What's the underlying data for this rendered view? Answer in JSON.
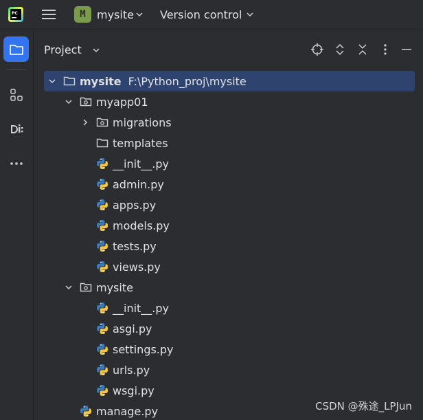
{
  "titlebar": {
    "app_logo_icon": "pycharm-logo-icon",
    "project_badge": "M",
    "project_name": "mysite",
    "vcs_label": "Version control",
    "badge_color": "#7a9a4c"
  },
  "panel": {
    "title": "Project"
  },
  "tree": [
    {
      "label": "mysite",
      "path": "F:\\Python_proj\\mysite",
      "type": "folder",
      "level": 0,
      "expanded": true,
      "selected": true
    },
    {
      "label": "myapp01",
      "type": "package",
      "level": 1,
      "expanded": true
    },
    {
      "label": "migrations",
      "type": "package",
      "level": 2,
      "expanded": false
    },
    {
      "label": "templates",
      "type": "folder",
      "level": 2
    },
    {
      "label": "__init__.py",
      "type": "python",
      "level": 2
    },
    {
      "label": "admin.py",
      "type": "python",
      "level": 2
    },
    {
      "label": "apps.py",
      "type": "python",
      "level": 2
    },
    {
      "label": "models.py",
      "type": "python",
      "level": 2
    },
    {
      "label": "tests.py",
      "type": "python",
      "level": 2
    },
    {
      "label": "views.py",
      "type": "python",
      "level": 2
    },
    {
      "label": "mysite",
      "type": "package",
      "level": 1,
      "expanded": true
    },
    {
      "label": "__init__.py",
      "type": "python",
      "level": 2
    },
    {
      "label": "asgi.py",
      "type": "python",
      "level": 2
    },
    {
      "label": "settings.py",
      "type": "python",
      "level": 2
    },
    {
      "label": "urls.py",
      "type": "python",
      "level": 2
    },
    {
      "label": "wsgi.py",
      "type": "python",
      "level": 2
    },
    {
      "label": "manage.py",
      "type": "python",
      "level": 1
    }
  ],
  "watermark": "CSDN @殊途_LPJun",
  "colors": {
    "background": "#2b2d30",
    "accent": "#3574f0",
    "selection": "#2e436e",
    "python_blue": "#3d7ab8",
    "python_yellow": "#f3c744"
  }
}
